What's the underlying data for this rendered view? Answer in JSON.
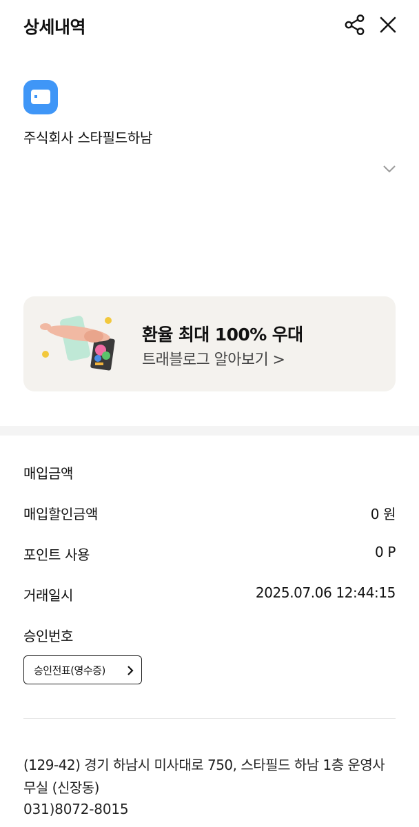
{
  "header": {
    "title": "상세내역",
    "share_icon": "share-icon",
    "close_icon": "close-icon"
  },
  "merchant": {
    "logo_icon": "card-icon",
    "logo_color": "#3f96f7",
    "name": "주식회사 스타필드하남",
    "expand_icon": "chevron-down-icon"
  },
  "promo": {
    "title": "환율 최대 100% 우대",
    "subtitle": "트래블로그 알아보기 >",
    "background": "#f4f2ee"
  },
  "details": {
    "purchase_amount_label": "매입금액",
    "purchase_discount_label": "매입할인금액",
    "purchase_discount_value": "0 원",
    "points_label": "포인트 사용",
    "points_value": "0 P",
    "datetime_label": "거래일시",
    "datetime_value": "2025.07.06 12:44:15",
    "approval_label": "승인번호",
    "receipt_button": "승인전표(영수증)"
  },
  "merchant_info": {
    "address": "(129-42) 경기 하남시 미사대로 750, 스타필드 하남 1층 운영사무실 (신장동)",
    "phone": "031)8072-8015"
  }
}
